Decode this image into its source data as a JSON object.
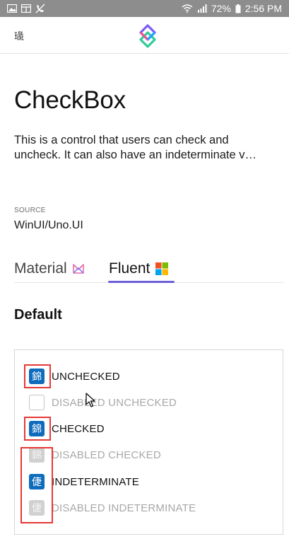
{
  "status_bar": {
    "left_icons": [
      "image-icon",
      "grid-icon",
      "phone-muted-icon"
    ],
    "battery": "72%",
    "time": "2:56 PM"
  },
  "app_bar": {
    "menu_glyph": "璏"
  },
  "page": {
    "title": "CheckBox",
    "description_line1": "This is a control that users can check and",
    "description_line2": "uncheck. It can also have an indeterminate v…",
    "source_label": "SOURCE",
    "source_value": "WinUI/Uno.UI"
  },
  "tabs": [
    {
      "label": "Material",
      "icon": "material-logo-icon",
      "selected": false
    },
    {
      "label": "Fluent",
      "icon": "windows-logo-icon",
      "selected": true
    }
  ],
  "section": {
    "title": "Default"
  },
  "checkboxes": [
    {
      "label": "UNCHECKED",
      "glyph": "錦",
      "state": "unchecked",
      "disabled": false
    },
    {
      "label": "DISABLED UNCHECKED",
      "glyph": "",
      "state": "unchecked",
      "disabled": true
    },
    {
      "label": "CHECKED",
      "glyph": "錦",
      "state": "checked",
      "disabled": false
    },
    {
      "label": "DISABLED CHECKED",
      "glyph": "錦",
      "state": "checked",
      "disabled": true
    },
    {
      "label": "INDETERMINATE",
      "glyph": "倢",
      "state": "indeterminate",
      "disabled": false
    },
    {
      "label": "DISABLED INDETERMINATE",
      "glyph": "倢",
      "state": "indeterminate",
      "disabled": true
    }
  ],
  "colors": {
    "accent": "#0f6cbd",
    "tab_indicator": "#6b5fd6",
    "highlight_box": "#e53935"
  }
}
